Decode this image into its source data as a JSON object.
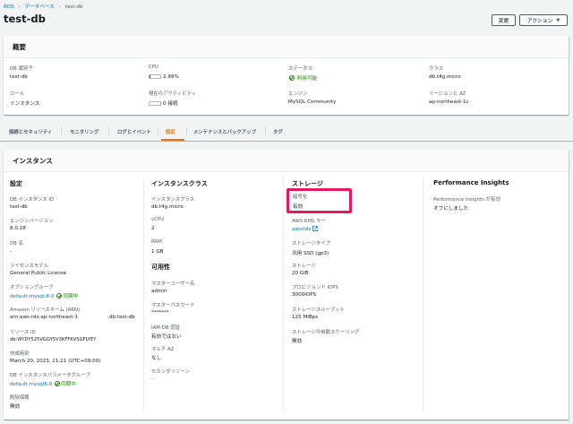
{
  "breadcrumb": {
    "root": "RDS",
    "section": "データベース",
    "current": "test-db"
  },
  "page_title": "test-db",
  "buttons": {
    "modify": "変更",
    "actions": "アクション"
  },
  "summary": {
    "title": "概要",
    "db_id_label": "DB 識別子",
    "db_id": "test-db",
    "cpu_label": "CPU",
    "cpu": "2.99%",
    "cpu_fraction": 0.0299,
    "status_label": "ステータス",
    "status": "利用可能",
    "class_label": "クラス",
    "class": "db.t4g.micro",
    "role_label": "ロール",
    "role": "インスタンス",
    "activity_label": "現在のアクティビティ",
    "activity": "0 接続",
    "activity_fraction": 0,
    "engine_label": "エンジン",
    "engine": "MySQL Community",
    "region_label": "リージョンと AZ",
    "region": "ap-northeast-1c"
  },
  "tabs": [
    {
      "label": "接続とセキュリティ"
    },
    {
      "label": "モニタリング"
    },
    {
      "label": "ログとイベント"
    },
    {
      "label": "設定"
    },
    {
      "label": "メンテナンスとバックアップ"
    },
    {
      "label": "タグ"
    }
  ],
  "instance": {
    "title": "インスタンス",
    "settings": {
      "heading": "設定",
      "db_instance_id_label": "DB インスタンス ID",
      "db_instance_id": "test-db",
      "engine_version_label": "エンジンバージョン",
      "engine_version": "8.0.28",
      "db_name_label": "DB 名",
      "db_name": "-",
      "license_label": "ライセンスモデル",
      "license": "General Public License",
      "option_group_label": "オプショングループ",
      "option_group": "default:mysql-8-0",
      "option_group_status": "同期中",
      "arn_label": "Amazon リソースネーム (ARN)",
      "arn_part1": "arn:aws:rds:ap-northeast-1",
      "arn_part2": ":db:test-db",
      "resource_id_label": "リソース ID",
      "resource_id": "db-WYDY525VGGY5V3KFFKVSGFLYEY",
      "created_label": "作成時刻",
      "created": "March 20, 2023, 21:21 (UTC+09:00)",
      "param_group_label": "DB インスタンスパラメータグループ",
      "param_group": "default.mysql8.0",
      "param_group_status": "同期中",
      "deletion_label": "削除保護",
      "deletion": "無効"
    },
    "instance_class": {
      "heading": "インスタンスクラス",
      "class_label": "インスタンスクラス",
      "class": "db.t4g.micro",
      "vcpu_label": "vCPU",
      "vcpu": "2",
      "ram_label": "RAM",
      "ram": "1 GB"
    },
    "availability": {
      "heading": "可用性",
      "master_user_label": "マスターユーザー名",
      "master_user": "admin",
      "master_password_label": "マスターパスワード",
      "master_password": "*******",
      "iam_label": "IAM DB 認証",
      "iam": "有効ではない",
      "multi_az_label": "マルチ AZ",
      "multi_az": "なし",
      "secondary_zone_label": "セカンダリゾーン",
      "secondary_zone": "-"
    },
    "storage": {
      "heading": "ストレージ",
      "encryption_label": "暗号化",
      "encryption": "有効",
      "kms_label": "AWS KMS キー",
      "kms": "aws/rds",
      "type_label": "ストレージタイプ",
      "type": "汎用 SSD (gp3)",
      "size_label": "ストレージ",
      "size": "20 GiB",
      "iops_label": "プロビジョンド IOPS",
      "iops": "3000IOPS",
      "throughput_label": "ストレージスループット",
      "throughput": "125 MiBps",
      "autoscaling_label": "ストレージの自動スケーリング",
      "autoscaling": "無効"
    },
    "performance": {
      "heading": "Performance Insights",
      "enabled_label": "Performance Insights が有効",
      "enabled": "オフにしました"
    }
  },
  "colors": {
    "accent": "#0073bb",
    "ok": "#1d8102",
    "active_tab": "#ec7211",
    "highlight": "#e8175d"
  }
}
